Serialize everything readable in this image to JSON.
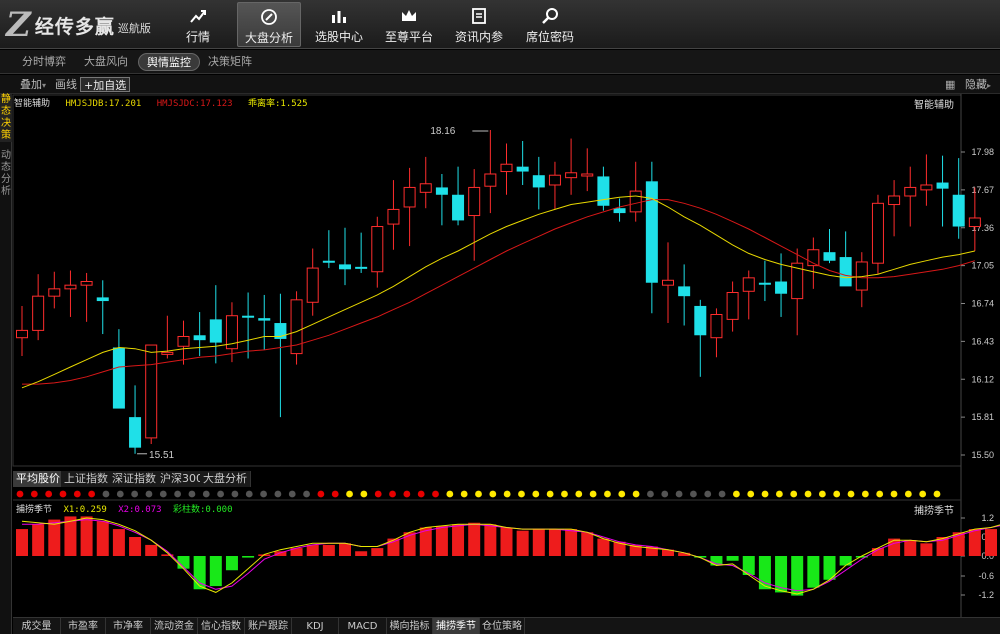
{
  "app": {
    "logo_mark": "Z",
    "brand": "经传多赢",
    "edition": "巡航版"
  },
  "nav": [
    {
      "label": "行情",
      "icon": "trend-up-icon"
    },
    {
      "label": "大盘分析",
      "icon": "compass-icon"
    },
    {
      "label": "选股中心",
      "icon": "bar-chart-icon"
    },
    {
      "label": "至尊平台",
      "icon": "crown-icon"
    },
    {
      "label": "资讯内参",
      "icon": "document-icon"
    },
    {
      "label": "席位密码",
      "icon": "search-icon"
    }
  ],
  "subtabs": [
    "分时博弈",
    "大盘风向",
    "舆情监控",
    "决策矩阵"
  ],
  "active_subtab": "舆情监控",
  "toolbar": {
    "overlay": "叠加",
    "overlay_caret": "▾",
    "line": "画线",
    "add_fav": "+加自选",
    "hide": "隐藏",
    "hide_caret": "▸"
  },
  "sidenav": [
    "静态决策",
    "动态分析"
  ],
  "main_indicator": {
    "name": "智能辅助",
    "name_right": "智能辅助",
    "v1_label": "HMJSJDB:17.201",
    "v2_label": "HMJSJDC:17.123",
    "v3_label": "乖离率:1.525",
    "high_marker": "18.16",
    "low_marker": "15.51"
  },
  "index_tabs": [
    "平均股价",
    "上证指数",
    "深证指数",
    "沪深300",
    "大盘分析"
  ],
  "active_index_tab": "平均股价",
  "sub_indicator": {
    "name": "捕捞季节",
    "name_right": "捕捞季节",
    "x1_label": "X1:0.259",
    "x2_label": "X2:0.073",
    "x3_label": "彩柱数:0.000"
  },
  "bottom_tabs": [
    "成交量",
    "市盈率",
    "市净率",
    "流动资金",
    "信心指数",
    "账户跟踪",
    "KDJ",
    "MACD",
    "横向指标",
    "捕捞季节",
    "仓位策略"
  ],
  "active_bottom_tab": "捕捞季节",
  "colors": {
    "up": "#ff2d2d",
    "down": "#1fe0e8",
    "ma1": "#e8d800",
    "ma2": "#d81818",
    "x1": "#e8e800",
    "x2": "#e800e8",
    "dot_red": "#e80000",
    "dot_yellow": "#ffea00",
    "dot_gray": "#555555"
  },
  "chart_data": [
    {
      "type": "candlestick",
      "title": "智能辅助",
      "yticks": [
        "17.98",
        "17.67",
        "17.36",
        "17.05",
        "16.74",
        "16.43",
        "16.12",
        "15.81",
        "15.50"
      ],
      "ylim": [
        15.5,
        17.98
      ],
      "candles": [
        {
          "o": 16.46,
          "h": 16.72,
          "l": 16.31,
          "c": 16.52
        },
        {
          "o": 16.52,
          "h": 16.98,
          "l": 16.44,
          "c": 16.8
        },
        {
          "o": 16.8,
          "h": 17.0,
          "l": 16.7,
          "c": 16.86
        },
        {
          "o": 16.86,
          "h": 17.01,
          "l": 16.63,
          "c": 16.89
        },
        {
          "o": 16.89,
          "h": 16.99,
          "l": 16.59,
          "c": 16.92
        },
        {
          "o": 16.79,
          "h": 16.93,
          "l": 16.49,
          "c": 16.76
        },
        {
          "o": 16.38,
          "h": 16.53,
          "l": 15.89,
          "c": 15.88
        },
        {
          "o": 15.81,
          "h": 16.07,
          "l": 15.51,
          "c": 15.56
        },
        {
          "o": 15.64,
          "h": 16.4,
          "l": 15.59,
          "c": 16.4
        },
        {
          "o": 16.34,
          "h": 16.64,
          "l": 16.29,
          "c": 16.34
        },
        {
          "o": 16.39,
          "h": 16.6,
          "l": 16.24,
          "c": 16.47
        },
        {
          "o": 16.48,
          "h": 16.67,
          "l": 16.31,
          "c": 16.44
        },
        {
          "o": 16.61,
          "h": 16.89,
          "l": 16.25,
          "c": 16.42
        },
        {
          "o": 16.37,
          "h": 16.75,
          "l": 16.26,
          "c": 16.64
        },
        {
          "o": 16.64,
          "h": 16.83,
          "l": 16.29,
          "c": 16.63
        },
        {
          "o": 16.62,
          "h": 16.81,
          "l": 16.36,
          "c": 16.6
        },
        {
          "o": 16.58,
          "h": 16.82,
          "l": 15.81,
          "c": 16.45
        },
        {
          "o": 16.33,
          "h": 16.84,
          "l": 16.24,
          "c": 16.77
        },
        {
          "o": 16.75,
          "h": 17.19,
          "l": 16.64,
          "c": 17.03
        },
        {
          "o": 17.09,
          "h": 17.34,
          "l": 17.03,
          "c": 17.08
        },
        {
          "o": 17.06,
          "h": 17.36,
          "l": 16.89,
          "c": 17.02
        },
        {
          "o": 17.04,
          "h": 17.32,
          "l": 16.99,
          "c": 17.03
        },
        {
          "o": 17.0,
          "h": 17.45,
          "l": 16.87,
          "c": 17.37
        },
        {
          "o": 17.39,
          "h": 17.75,
          "l": 17.18,
          "c": 17.51
        },
        {
          "o": 17.53,
          "h": 17.85,
          "l": 17.21,
          "c": 17.69
        },
        {
          "o": 17.65,
          "h": 17.94,
          "l": 17.52,
          "c": 17.72
        },
        {
          "o": 17.69,
          "h": 17.8,
          "l": 17.38,
          "c": 17.63
        },
        {
          "o": 17.63,
          "h": 17.86,
          "l": 17.38,
          "c": 17.42
        },
        {
          "o": 17.46,
          "h": 17.84,
          "l": 17.09,
          "c": 17.69
        },
        {
          "o": 17.7,
          "h": 18.16,
          "l": 17.48,
          "c": 17.8
        },
        {
          "o": 17.82,
          "h": 18.05,
          "l": 17.63,
          "c": 17.88
        },
        {
          "o": 17.86,
          "h": 18.07,
          "l": 17.71,
          "c": 17.82
        },
        {
          "o": 17.79,
          "h": 17.94,
          "l": 17.51,
          "c": 17.69
        },
        {
          "o": 17.71,
          "h": 17.9,
          "l": 17.51,
          "c": 17.79
        },
        {
          "o": 17.77,
          "h": 18.09,
          "l": 17.63,
          "c": 17.81
        },
        {
          "o": 17.79,
          "h": 18.01,
          "l": 17.66,
          "c": 17.8
        },
        {
          "o": 17.78,
          "h": 17.86,
          "l": 17.5,
          "c": 17.54
        },
        {
          "o": 17.52,
          "h": 17.6,
          "l": 17.41,
          "c": 17.48
        },
        {
          "o": 17.49,
          "h": 17.9,
          "l": 17.41,
          "c": 17.66
        },
        {
          "o": 17.74,
          "h": 17.9,
          "l": 16.66,
          "c": 16.91
        },
        {
          "o": 16.89,
          "h": 17.24,
          "l": 16.58,
          "c": 16.93
        },
        {
          "o": 16.88,
          "h": 17.06,
          "l": 16.56,
          "c": 16.8
        },
        {
          "o": 16.72,
          "h": 16.77,
          "l": 16.14,
          "c": 16.48
        },
        {
          "o": 16.46,
          "h": 16.7,
          "l": 16.3,
          "c": 16.65
        },
        {
          "o": 16.61,
          "h": 16.92,
          "l": 16.51,
          "c": 16.83
        },
        {
          "o": 16.84,
          "h": 17.01,
          "l": 16.61,
          "c": 16.95
        },
        {
          "o": 16.91,
          "h": 17.09,
          "l": 16.76,
          "c": 16.9
        },
        {
          "o": 16.92,
          "h": 17.15,
          "l": 16.63,
          "c": 16.82
        },
        {
          "o": 16.78,
          "h": 17.19,
          "l": 16.48,
          "c": 17.07
        },
        {
          "o": 17.05,
          "h": 17.28,
          "l": 16.86,
          "c": 17.18
        },
        {
          "o": 17.16,
          "h": 17.35,
          "l": 17.07,
          "c": 17.09
        },
        {
          "o": 17.12,
          "h": 17.33,
          "l": 16.89,
          "c": 16.88
        },
        {
          "o": 16.85,
          "h": 17.16,
          "l": 16.71,
          "c": 17.08
        },
        {
          "o": 17.07,
          "h": 17.63,
          "l": 16.98,
          "c": 17.56
        },
        {
          "o": 17.55,
          "h": 17.75,
          "l": 17.29,
          "c": 17.62
        },
        {
          "o": 17.62,
          "h": 17.86,
          "l": 17.37,
          "c": 17.69
        },
        {
          "o": 17.67,
          "h": 17.96,
          "l": 17.54,
          "c": 17.71
        },
        {
          "o": 17.73,
          "h": 17.95,
          "l": 17.37,
          "c": 17.68
        },
        {
          "o": 17.63,
          "h": 17.93,
          "l": 17.27,
          "c": 17.37
        },
        {
          "o": 17.37,
          "h": 17.69,
          "l": 17.17,
          "c": 17.44
        }
      ],
      "ma1": [
        16.05,
        16.1,
        16.16,
        16.22,
        16.28,
        16.34,
        16.38,
        16.37,
        16.34,
        16.35,
        16.37,
        16.38,
        16.39,
        16.41,
        16.44,
        16.47,
        16.47,
        16.51,
        16.57,
        16.63,
        16.69,
        16.75,
        16.81,
        16.88,
        16.96,
        17.04,
        17.11,
        17.17,
        17.24,
        17.31,
        17.37,
        17.42,
        17.47,
        17.51,
        17.55,
        17.57,
        17.59,
        17.61,
        17.62,
        17.6,
        17.53,
        17.45,
        17.38,
        17.3,
        17.22,
        17.15,
        17.1,
        17.06,
        17.03,
        17.0,
        16.97,
        16.95,
        16.96,
        16.98,
        17.02,
        17.06,
        17.09,
        17.12,
        17.14,
        17.17
      ],
      "ma2": [
        16.08,
        16.08,
        16.09,
        16.11,
        16.14,
        16.18,
        16.22,
        16.23,
        16.24,
        16.26,
        16.28,
        16.3,
        16.31,
        16.33,
        16.35,
        16.36,
        16.38,
        16.4,
        16.44,
        16.48,
        16.53,
        16.58,
        16.63,
        16.69,
        16.75,
        16.82,
        16.89,
        16.96,
        17.03,
        17.1,
        17.17,
        17.23,
        17.29,
        17.35,
        17.4,
        17.45,
        17.49,
        17.53,
        17.56,
        17.59,
        17.59,
        17.56,
        17.52,
        17.47,
        17.41,
        17.35,
        17.28,
        17.21,
        17.14,
        17.07,
        17.01,
        16.97,
        16.95,
        16.95,
        16.96,
        16.98,
        17.0,
        17.02,
        17.05,
        17.09
      ]
    },
    {
      "type": "bar",
      "title": "捕捞季节",
      "yticks": [
        "1.2",
        "0.6",
        "0.0",
        "-0.6",
        "-1.2"
      ],
      "ylim": [
        -1.65,
        1.55
      ],
      "values": [
        0.85,
        1.0,
        1.15,
        1.25,
        1.25,
        1.1,
        0.85,
        0.6,
        0.35,
        0.05,
        -0.4,
        -1.05,
        -0.95,
        -0.45,
        -0.05,
        0.05,
        0.15,
        0.25,
        0.35,
        0.35,
        0.4,
        0.15,
        0.25,
        0.55,
        0.75,
        0.9,
        0.95,
        1.0,
        1.05,
        1.0,
        0.9,
        0.8,
        0.85,
        0.85,
        0.85,
        0.75,
        0.55,
        0.45,
        0.35,
        0.3,
        0.2,
        0.1,
        -0.05,
        -0.3,
        -0.15,
        -0.6,
        -1.05,
        -1.15,
        -1.25,
        -1.0,
        -0.75,
        -0.3,
        -0.05,
        0.25,
        0.55,
        0.5,
        0.4,
        0.6,
        0.75,
        0.85
      ],
      "extra_values": [
        0.85,
        1.05,
        0.7,
        0.35,
        0.1
      ],
      "x1": [
        1.1,
        1.05,
        1.0,
        1.1,
        1.2,
        1.15,
        1.0,
        0.8,
        0.5,
        0.1,
        -0.4,
        -0.95,
        -1.15,
        -0.85,
        -0.4,
        0.05,
        0.2,
        0.3,
        0.4,
        0.4,
        0.4,
        0.3,
        0.3,
        0.5,
        0.75,
        0.9,
        0.95,
        1.0,
        1.0,
        1.0,
        0.9,
        0.85,
        0.85,
        0.85,
        0.85,
        0.75,
        0.55,
        0.4,
        0.3,
        0.25,
        0.2,
        0.1,
        -0.05,
        -0.3,
        -0.25,
        -0.6,
        -0.95,
        -1.1,
        -1.2,
        -1.05,
        -0.75,
        -0.3,
        0.0,
        0.25,
        0.5,
        0.5,
        0.45,
        0.55,
        0.7,
        0.85,
        0.9,
        1.05,
        0.85,
        0.45,
        0.15
      ],
      "x2": [
        1.0,
        1.0,
        1.05,
        1.1,
        1.15,
        1.1,
        0.95,
        0.75,
        0.5,
        0.15,
        -0.35,
        -0.85,
        -1.05,
        -0.95,
        -0.55,
        -0.1,
        0.1,
        0.25,
        0.35,
        0.4,
        0.4,
        0.3,
        0.3,
        0.45,
        0.65,
        0.8,
        0.9,
        0.95,
        1.0,
        0.95,
        0.9,
        0.85,
        0.85,
        0.85,
        0.8,
        0.75,
        0.6,
        0.45,
        0.35,
        0.3,
        0.2,
        0.1,
        -0.05,
        -0.25,
        -0.3,
        -0.55,
        -0.85,
        -1.0,
        -1.1,
        -1.05,
        -0.8,
        -0.45,
        -0.1,
        0.2,
        0.4,
        0.5,
        0.45,
        0.5,
        0.65,
        0.8,
        0.9,
        1.0,
        0.9,
        0.55,
        0.2
      ]
    }
  ],
  "signal_dots": [
    "r",
    "r",
    "r",
    "r",
    "r",
    "r",
    "g",
    "g",
    "g",
    "g",
    "g",
    "g",
    "g",
    "g",
    "g",
    "g",
    "g",
    "g",
    "g",
    "g",
    "g",
    "r",
    "r",
    "y",
    "y",
    "r",
    "r",
    "r",
    "r",
    "r",
    "y",
    "y",
    "y",
    "y",
    "y",
    "y",
    "y",
    "y",
    "y",
    "y",
    "y",
    "y",
    "y",
    "y",
    "g",
    "g",
    "g",
    "g",
    "g",
    "g",
    "y",
    "y",
    "y",
    "y",
    "y",
    "y",
    "y",
    "y",
    "y",
    "y",
    "y",
    "y",
    "y",
    "y",
    "y"
  ]
}
